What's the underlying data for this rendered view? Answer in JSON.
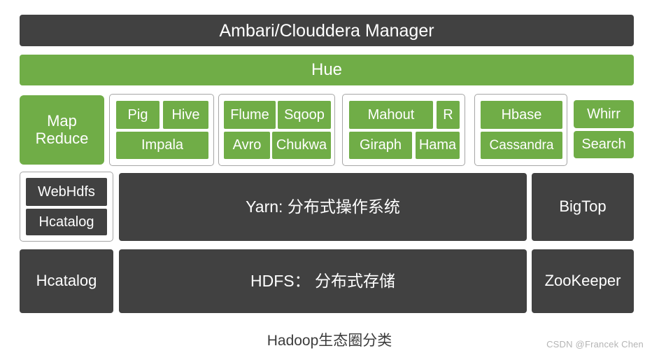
{
  "colors": {
    "green": "#70ad47",
    "dark": "#414141",
    "group_border": "#a6a6a6",
    "text_on_fill": "#ffffff",
    "caption": "#3c3c3c",
    "watermark": "#b4b4b4"
  },
  "banner": {
    "management": "Ambari/Clouddera Manager",
    "ui": "Hue"
  },
  "compute": {
    "mapreduce": "Map\nReduce"
  },
  "groups": {
    "query": {
      "items": [
        "Pig",
        "Hive",
        "Impala"
      ]
    },
    "ingest": {
      "items": [
        "Flume",
        "Sqoop",
        "Avro",
        "Chukwa"
      ]
    },
    "analytics": {
      "items": [
        "Mahout",
        "R",
        "Giraph",
        "Hama"
      ]
    },
    "nosql": {
      "items": [
        "Hbase",
        "Cassandra"
      ]
    }
  },
  "standalone_tools": {
    "items": [
      "Whirr",
      "Search"
    ]
  },
  "metadata_group": {
    "items": [
      "WebHdfs",
      "Hcatalog"
    ]
  },
  "layers": {
    "yarn": "Yarn: 分布式操作系统",
    "hdfs": "HDFS： 分布式存储"
  },
  "left_column": {
    "hcatalog": "Hcatalog"
  },
  "right_column": {
    "bigtop": "BigTop",
    "zookeeper": "ZooKeeper"
  },
  "caption": "Hadoop生态圈分类",
  "watermark": "CSDN @Francek Chen"
}
